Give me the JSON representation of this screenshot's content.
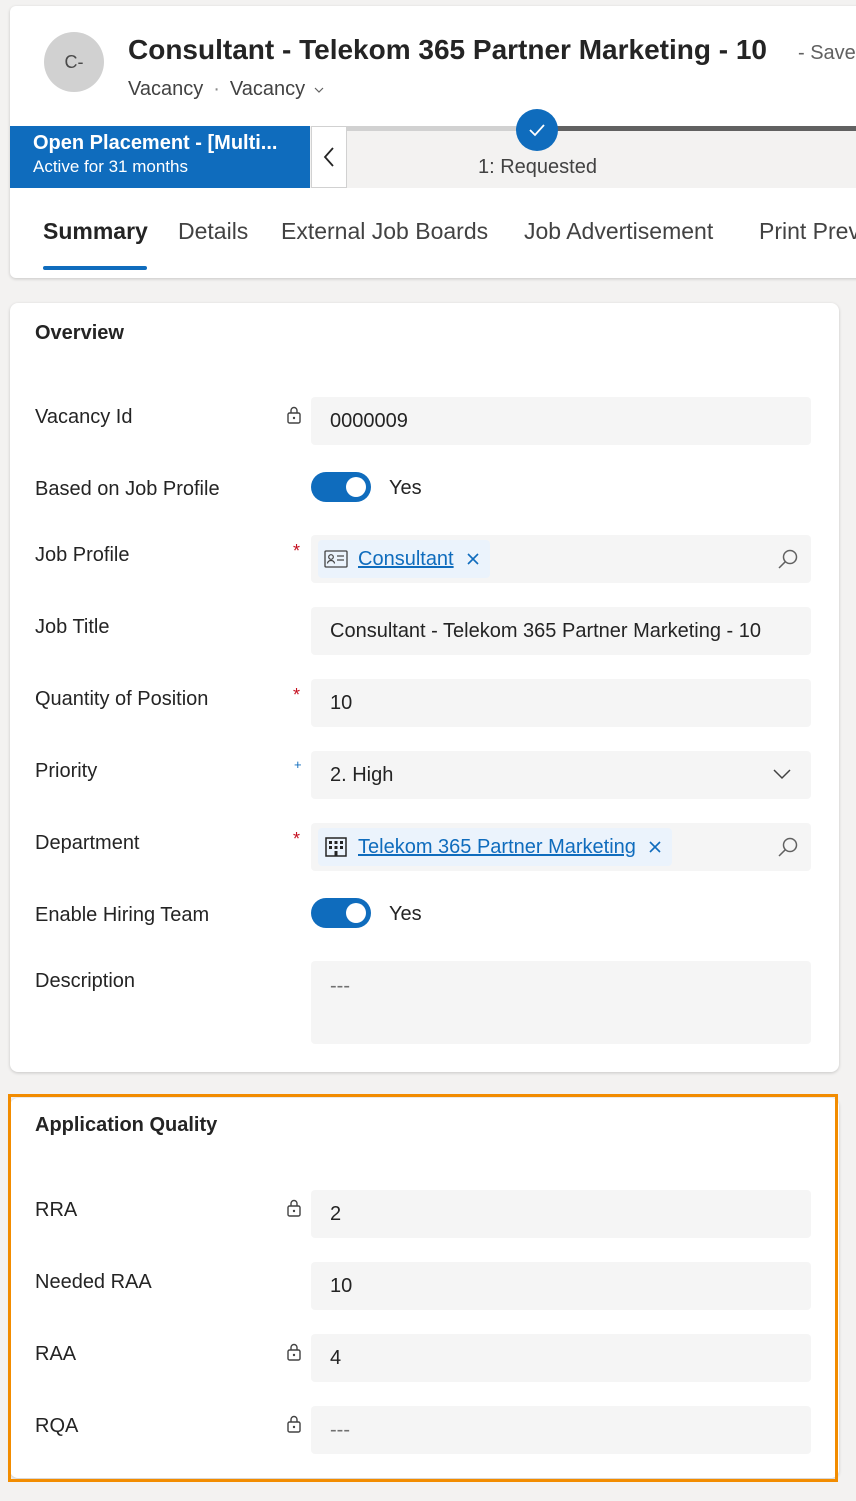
{
  "header": {
    "avatar_initials": "C-",
    "title": "Consultant - Telekom 365 Partner Marketing - 10",
    "save_status": "- Saved",
    "entity_type": "Vacancy",
    "separator": "·",
    "form_name": "Vacancy"
  },
  "bpf": {
    "stage_name": "Open Placement - [Multi...",
    "stage_duration": "Active for 31 months",
    "current_stage_label": "1: Requested"
  },
  "tabs": [
    "Summary",
    "Details",
    "External Job Boards",
    "Job Advertisement",
    "Print Preview"
  ],
  "overview": {
    "title": "Overview",
    "vacancy_id_label": "Vacancy Id",
    "vacancy_id_value": "0000009",
    "based_on_job_profile_label": "Based on Job Profile",
    "based_on_job_profile_value": "Yes",
    "job_profile_label": "Job Profile",
    "job_profile_value": "Consultant",
    "job_title_label": "Job Title",
    "job_title_value": "Consultant - Telekom 365 Partner Marketing - 10",
    "quantity_label": "Quantity of Position",
    "quantity_value": "10",
    "priority_label": "Priority",
    "priority_value": "2. High",
    "department_label": "Department",
    "department_value": "Telekom 365 Partner Marketing",
    "enable_hiring_team_label": "Enable Hiring Team",
    "enable_hiring_team_value": "Yes",
    "description_label": "Description",
    "description_value": "---",
    "required_marker": "*",
    "recommended_marker": "+"
  },
  "application_quality": {
    "title": "Application Quality",
    "rra_label": "RRA",
    "rra_value": "2",
    "needed_raa_label": "Needed RAA",
    "needed_raa_value": "10",
    "raa_label": "RAA",
    "raa_value": "4",
    "rqa_label": "RQA",
    "rqa_value": "---"
  },
  "colors": {
    "accent": "#0f6cbd",
    "highlight": "#f28c00",
    "required": "#c50f1f"
  }
}
